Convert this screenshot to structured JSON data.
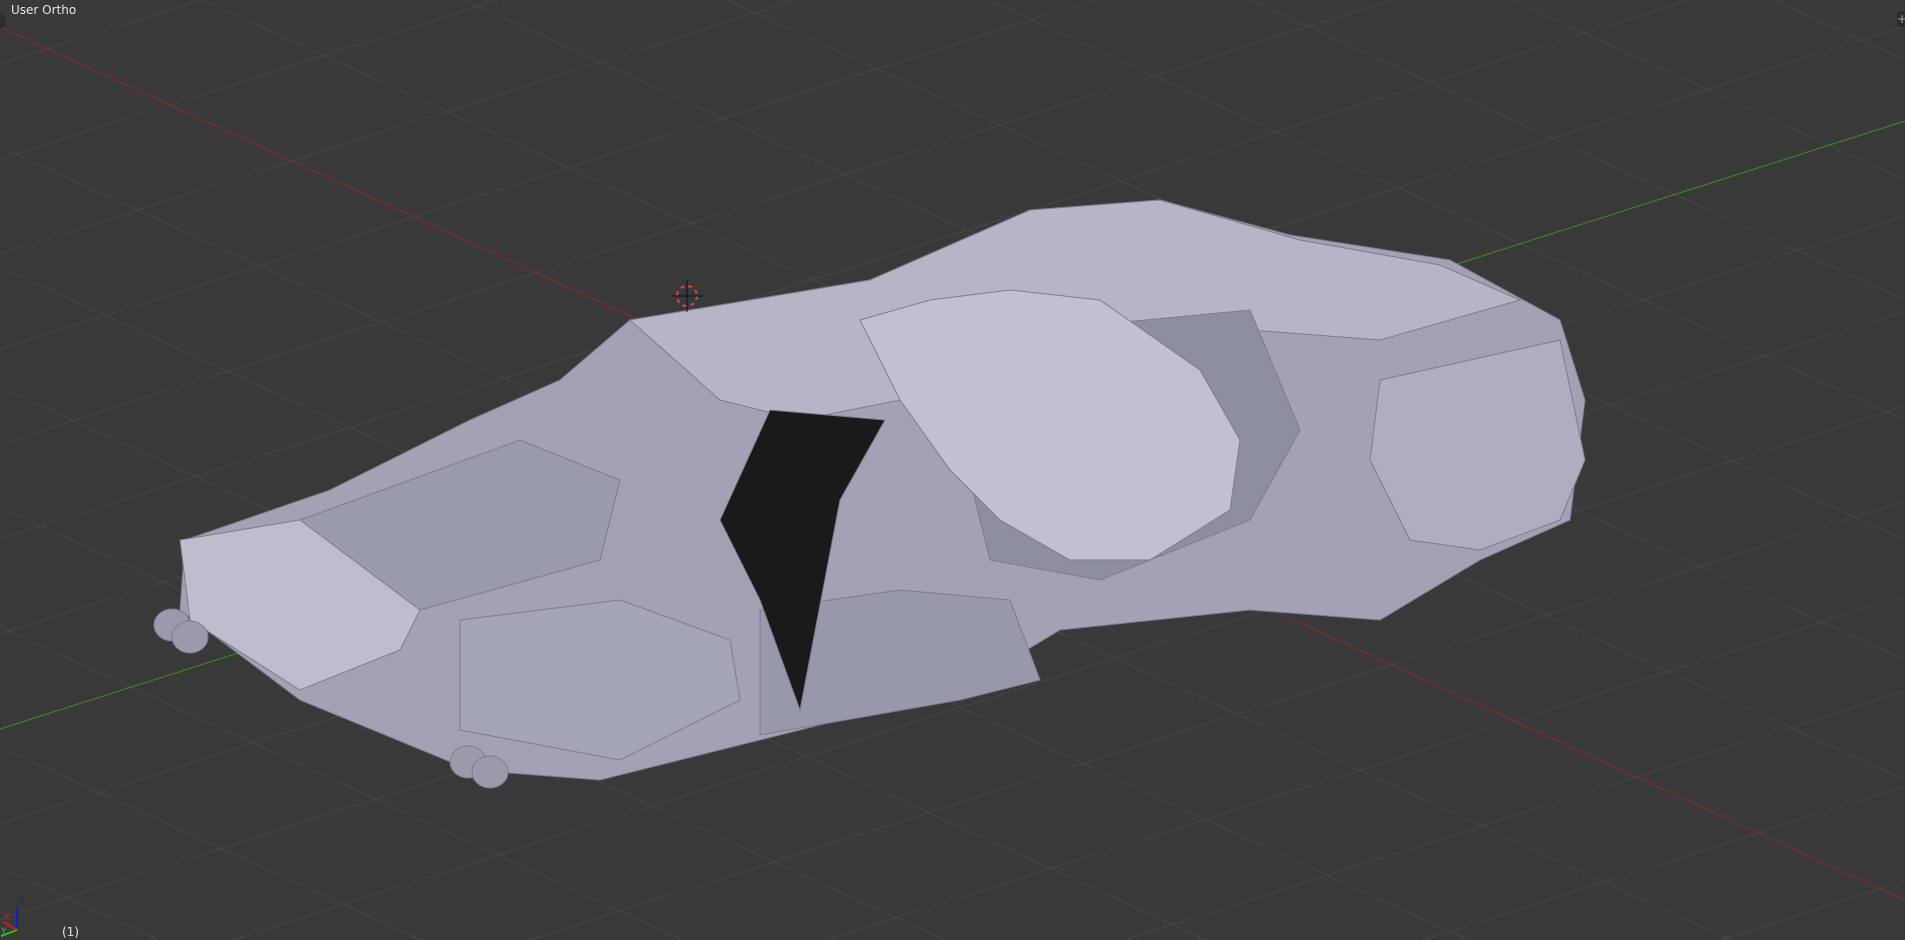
{
  "viewport": {
    "view_name": "User Ortho",
    "frame_label": "(1)",
    "axis_gizmo": {
      "x": "X",
      "y": "Y",
      "z": "Z"
    },
    "colors": {
      "background": "#393939",
      "grid": "#474747",
      "x_axis": "#8a2a2a",
      "y_axis": "#3f8a2a",
      "mesh": "#a9a9bd"
    }
  }
}
